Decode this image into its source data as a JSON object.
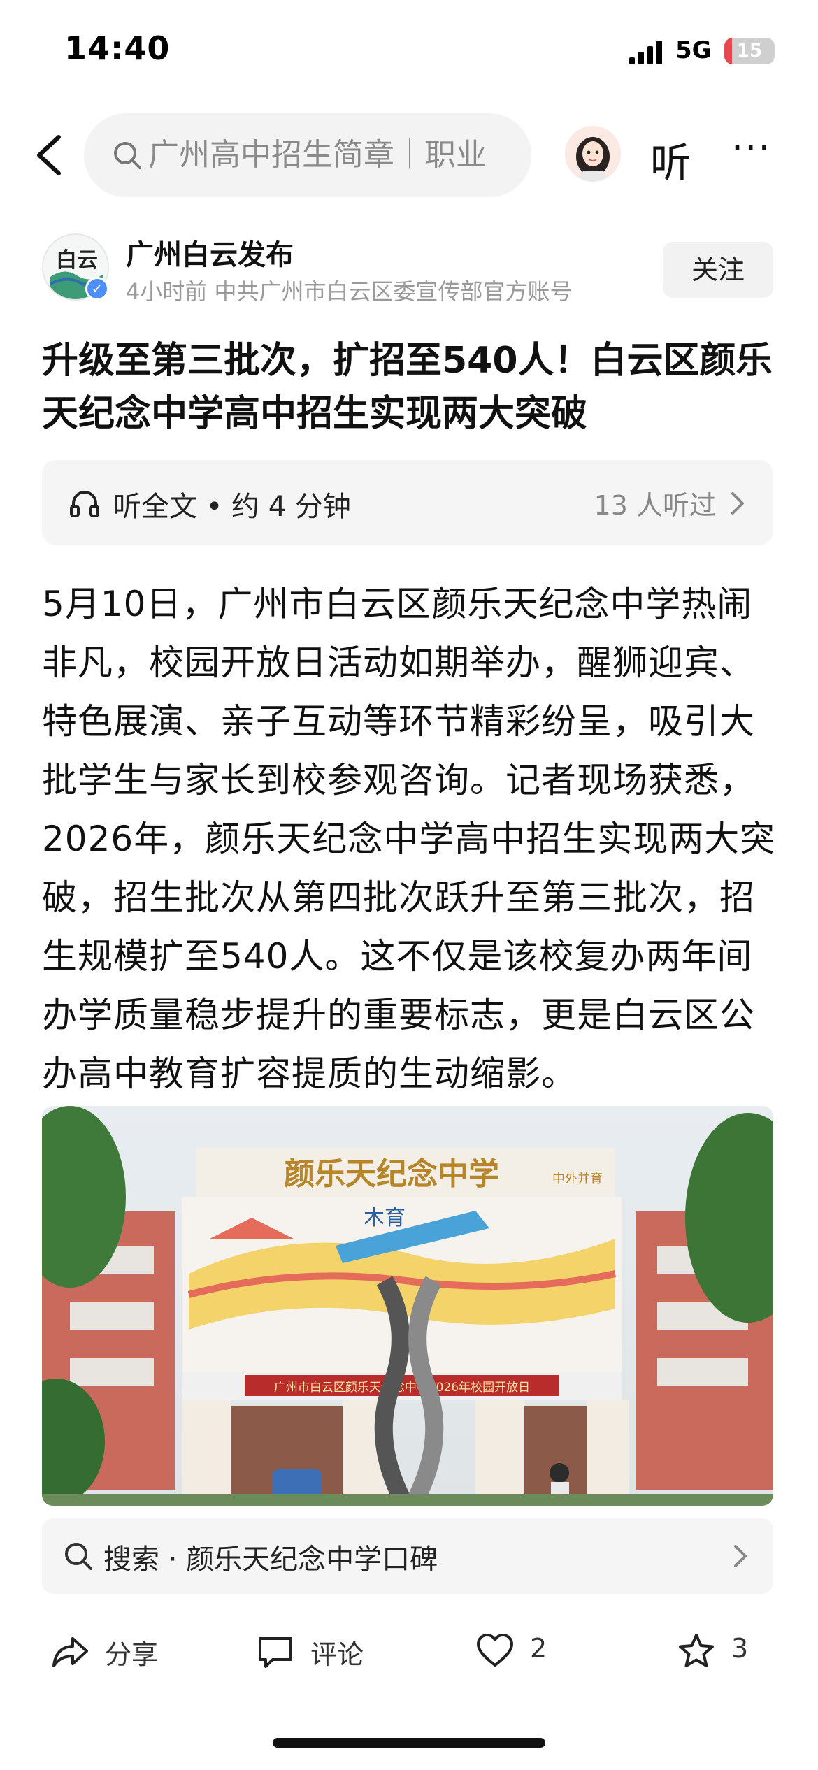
{
  "status_bar": {
    "time": "14:40",
    "network": "5G",
    "battery": 15
  },
  "nav": {
    "search_text": "广州高中招生简章｜职业",
    "listen_label": "听",
    "more_label": "···"
  },
  "author": {
    "name": "广州白云发布",
    "meta": "4小时前   中共广州市白云区委宣传部官方账号",
    "avatar_text": "白云",
    "follow_label": "关注"
  },
  "article": {
    "title": "升级至第三批次，扩招至540人！白云区颜乐天纪念中学高中招生实现两大突破",
    "audio_label": "听全文 • 约 4 分钟",
    "audio_count": "13 人听过",
    "body": "5月10日，广州市白云区颜乐天纪念中学热闹非凡，校园开放日活动如期举办，醒狮迎宾、特色展演、亲子互动等环节精彩纷呈，吸引大批学生与家长到校参观咨询。记者现场获悉，2026年，颜乐天纪念中学高中招生实现两大突破，招生批次从第四批次跃升至第三批次，招生规模扩至540人。这不仅是该校复办两年间办学质量稳步提升的重要标志，更是白云区公办高中教育扩容提质的生动缩影。"
  },
  "photo": {
    "school_name": "颜乐天纪念中学",
    "tagline": "木育",
    "motto": "中外并育",
    "banner": "广州市白云区颜乐天纪念中学2026年校园开放日"
  },
  "related": {
    "text": "搜索 · 颜乐天纪念中学口碑"
  },
  "actions": {
    "share": "分享",
    "comment": "评论",
    "like_count": "2",
    "favorite_count": "3"
  },
  "colors": {
    "accent_blue": "#4e8ef7",
    "battery_red": "#e5484d"
  }
}
